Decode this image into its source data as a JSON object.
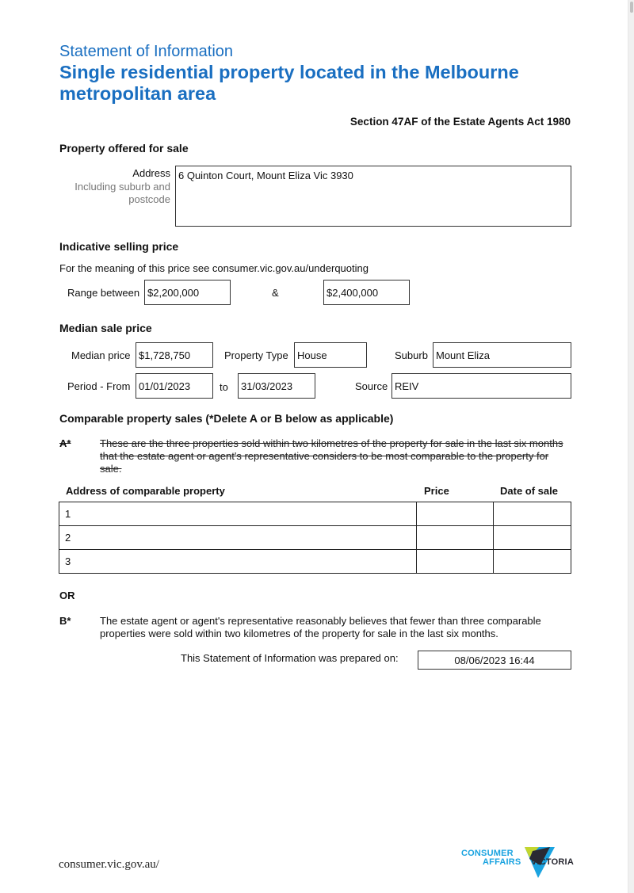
{
  "header": {
    "doc_type": "Statement of Information",
    "title": "Single residential property located in the Melbourne metropolitan area",
    "act_reference": "Section 47AF of the Estate Agents Act 1980"
  },
  "property": {
    "heading": "Property offered for sale",
    "address_label": "Address",
    "address_sublabel": "Including suburb and postcode",
    "address_value": "6 Quinton Court, Mount Eliza Vic 3930"
  },
  "indicative_price": {
    "heading": "Indicative selling price",
    "note": "For the meaning of this price see consumer.vic.gov.au/underquoting",
    "range_label": "Range between",
    "range_low": "$2,200,000",
    "ampersand": "&",
    "range_high": "$2,400,000"
  },
  "median": {
    "heading": "Median sale price",
    "median_price_label": "Median price",
    "median_price_value": "$1,728,750",
    "property_type_label": "Property Type",
    "property_type_value": "House",
    "suburb_label": "Suburb",
    "suburb_value": "Mount Eliza",
    "period_from_label": "Period - From",
    "period_from_value": "01/01/2023",
    "to_label": "to",
    "period_to_value": "31/03/2023",
    "source_label": "Source",
    "source_value": "REIV"
  },
  "comparable": {
    "heading": "Comparable property sales (*Delete A or B below as applicable)",
    "option_a_marker": "A*",
    "option_a_text": "These are the three properties sold within two kilometres of the property for sale in the last six months that the estate agent or agent's representative considers to be most comparable to the property for sale.",
    "table_headers": [
      "Address of comparable property",
      "Price",
      "Date of sale"
    ],
    "rows": [
      {
        "address": "1",
        "price": "",
        "date": ""
      },
      {
        "address": "2",
        "price": "",
        "date": ""
      },
      {
        "address": "3",
        "price": "",
        "date": ""
      }
    ],
    "or_label": "OR",
    "option_b_marker": "B*",
    "option_b_text": "The estate agent or agent's representative reasonably believes that fewer than three comparable properties were sold within two kilometres of the property for sale in the last six months.",
    "prepared_label": "This Statement of Information was prepared on:",
    "prepared_value": "08/06/2023 16:44"
  },
  "footer": {
    "url": "consumer.vic.gov.au/",
    "logo_line1": "CONSUMER",
    "logo_line2": "AFFAIRS",
    "logo_line3": "VICTORIA",
    "brand_blue": "#1aa3e0",
    "brand_lime": "#c4d62e",
    "brand_dark": "#2a2a33"
  }
}
